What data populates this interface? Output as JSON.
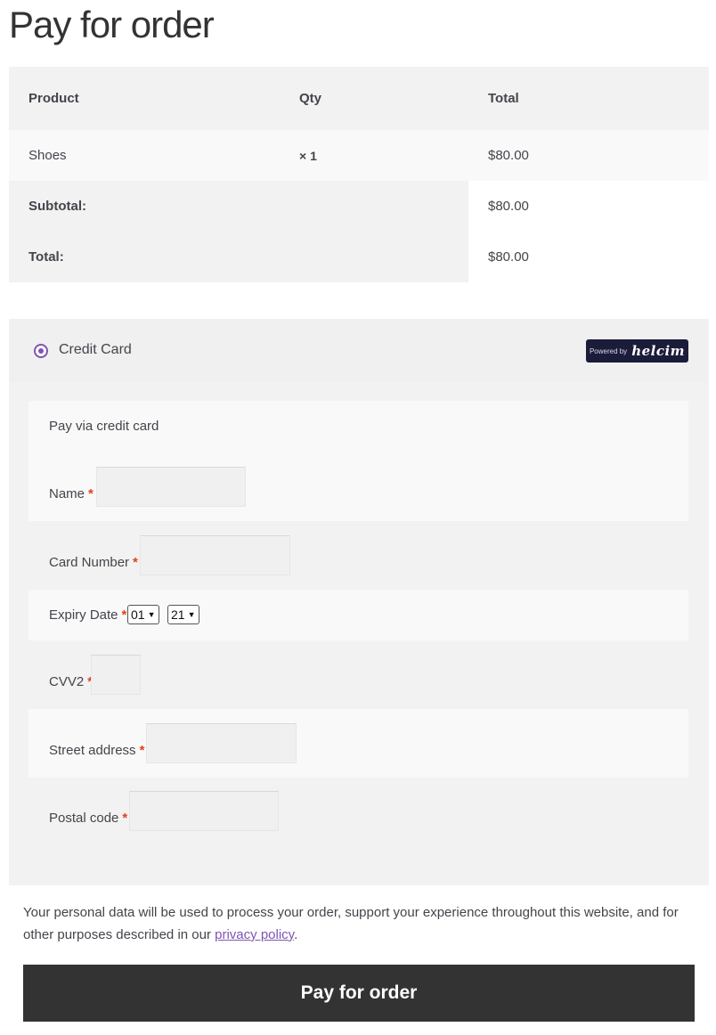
{
  "page": {
    "title": "Pay for order"
  },
  "order": {
    "headers": {
      "product": "Product",
      "qty": "Qty",
      "total": "Total"
    },
    "items": [
      {
        "product": "Shoes",
        "qty": "× 1",
        "total": "$80.00"
      }
    ],
    "subtotal_label": "Subtotal:",
    "subtotal_value": "$80.00",
    "total_label": "Total:",
    "total_value": "$80.00"
  },
  "payment": {
    "method_label": "Credit Card",
    "badge": {
      "powered_by": "Powered by",
      "brand": "helcim"
    },
    "description": "Pay via credit card",
    "fields": {
      "name_label": "Name",
      "card_number_label": "Card Number",
      "expiry_label": "Expiry Date",
      "expiry_month": "01",
      "expiry_year": "21",
      "cvv_label": "CVV2",
      "street_label": "Street address",
      "postal_label": "Postal code",
      "required_mark": "*"
    }
  },
  "notice": {
    "text_before": "Your personal data will be used to process your order, support your experience throughout this website, and for other purposes described in our ",
    "link_text": "privacy policy",
    "text_after": "."
  },
  "pay_button": {
    "label": "Pay for order"
  },
  "colors": {
    "accent": "#7f54b3",
    "required": "#e2401c",
    "button_bg": "#333333",
    "badge_bg": "#1b1b3a"
  }
}
